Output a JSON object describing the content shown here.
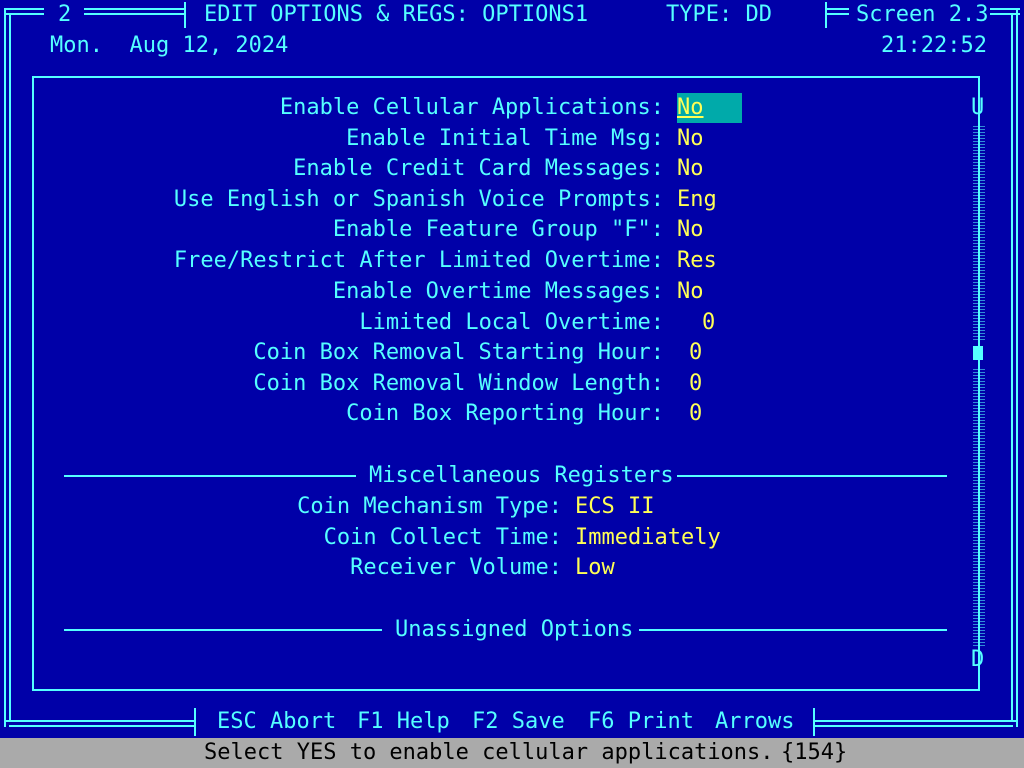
{
  "header": {
    "window_number": "2",
    "title": "EDIT OPTIONS & REGS: OPTIONS1",
    "type_label": "TYPE: DD",
    "screen_label": "Screen 2.3",
    "date": "Mon.  Aug 12, 2024",
    "time": "21:22:52"
  },
  "options": [
    {
      "label": "Enable Cellular Applications:",
      "value": "No"
    },
    {
      "label": "Enable Initial Time Msg:",
      "value": "No"
    },
    {
      "label": "Enable Credit Card Messages:",
      "value": "No"
    },
    {
      "label": "Use English or Spanish Voice Prompts:",
      "value": "Eng"
    },
    {
      "label": "Enable Feature Group \"F\":",
      "value": "No"
    },
    {
      "label": "Free/Restrict After Limited Overtime:",
      "value": "Res"
    },
    {
      "label": "Enable Overtime Messages:",
      "value": "No"
    },
    {
      "label": "Limited Local Overtime:",
      "value": "0"
    },
    {
      "label": "Coin Box Removal Starting Hour:",
      "value": "0"
    },
    {
      "label": "Coin Box Removal Window Length:",
      "value": "0"
    },
    {
      "label": "Coin Box Reporting Hour:",
      "value": "0"
    }
  ],
  "misc": {
    "section_title": "Miscellaneous Registers",
    "registers": [
      {
        "label": "Coin Mechanism Type:",
        "value": "ECS II"
      },
      {
        "label": "Coin Collect Time:",
        "value": "Immediately"
      },
      {
        "label": "Receiver Volume:",
        "value": "Low"
      }
    ]
  },
  "unassigned": {
    "section_title": "Unassigned Options"
  },
  "scrollbar": {
    "up_label": "U",
    "down_label": "D"
  },
  "footer": {
    "keys": [
      {
        "key": "ESC",
        "action": "Abort"
      },
      {
        "key": "F1",
        "action": "Help"
      },
      {
        "key": "F2",
        "action": "Save"
      },
      {
        "key": "F6",
        "action": "Print"
      },
      {
        "key": "",
        "action": "Arrows"
      }
    ]
  },
  "status": {
    "message": "Select YES to enable cellular applications.",
    "code": "{154}"
  },
  "colors": {
    "background": "#0000a8",
    "text": "#55ffff",
    "value": "#ffff55",
    "highlight": "#00aaaa",
    "status_bg": "#aaaaaa"
  }
}
